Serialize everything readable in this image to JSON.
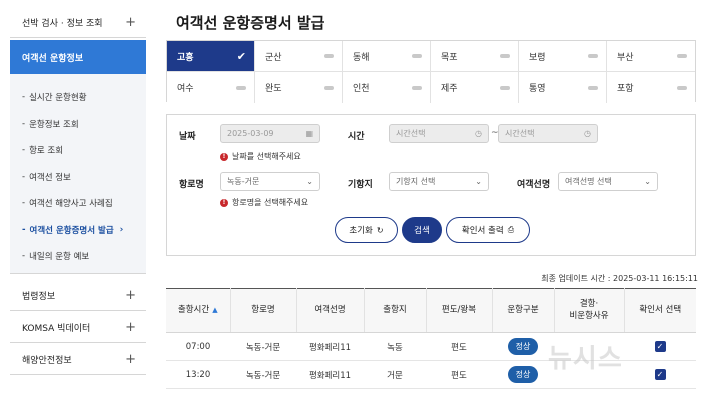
{
  "sidebar": {
    "top_item": "선박 검사 · 정보 조회",
    "active_item": "여객선 운항정보",
    "sub_items": [
      "실시간 운항현황",
      "운항정보 조회",
      "항로 조회",
      "여객선 정보",
      "여객선 해양사고 사례집",
      "여객선 운항증명서 발급",
      "내일의 운항 예보"
    ],
    "current_sub_item": "여객선 운항증명서 발급",
    "bottom_items": [
      "법령정보",
      "KOMSA 빅데이터",
      "해양안전정보"
    ]
  },
  "page": {
    "title": "여객선 운항증명서 발급"
  },
  "ports": {
    "selected": "고흥",
    "items": [
      "고흥",
      "군산",
      "동해",
      "목포",
      "보령",
      "부산",
      "여수",
      "완도",
      "인천",
      "제주",
      "통영",
      "포항"
    ]
  },
  "form": {
    "date_label": "날짜",
    "date_value": "2025-03-09",
    "date_error": "날짜를 선택해주세요",
    "time_label": "시간",
    "time_start_placeholder": "시간선택",
    "time_end_placeholder": "시간선택",
    "time_separator": "~",
    "route_label": "항로명",
    "route_value": "녹동-거문",
    "route_error": "항로명을 선택해주세요",
    "port_label": "기항지",
    "port_value": "기항지 선택",
    "ship_label": "여객선명",
    "ship_value": "여객선명 선택",
    "reset_button": "초기화",
    "search_button": "검색",
    "print_button": "확인서 출력"
  },
  "updated": "최종 업데이트 시간 : 2025-03-11 16:15:11",
  "table": {
    "headers": [
      "출항시간",
      "항로명",
      "여객선명",
      "출항지",
      "편도/왕복",
      "운항구분",
      "결항·\n비운항사유",
      "확인서 선택"
    ],
    "rows": [
      [
        "07:00",
        "녹동-거문",
        "평화페리11",
        "녹동",
        "편도",
        "정상",
        "",
        ""
      ],
      [
        "13:20",
        "녹동-거문",
        "평화페리11",
        "거문",
        "편도",
        "정상",
        "",
        ""
      ]
    ]
  },
  "watermark": "뉴시스"
}
